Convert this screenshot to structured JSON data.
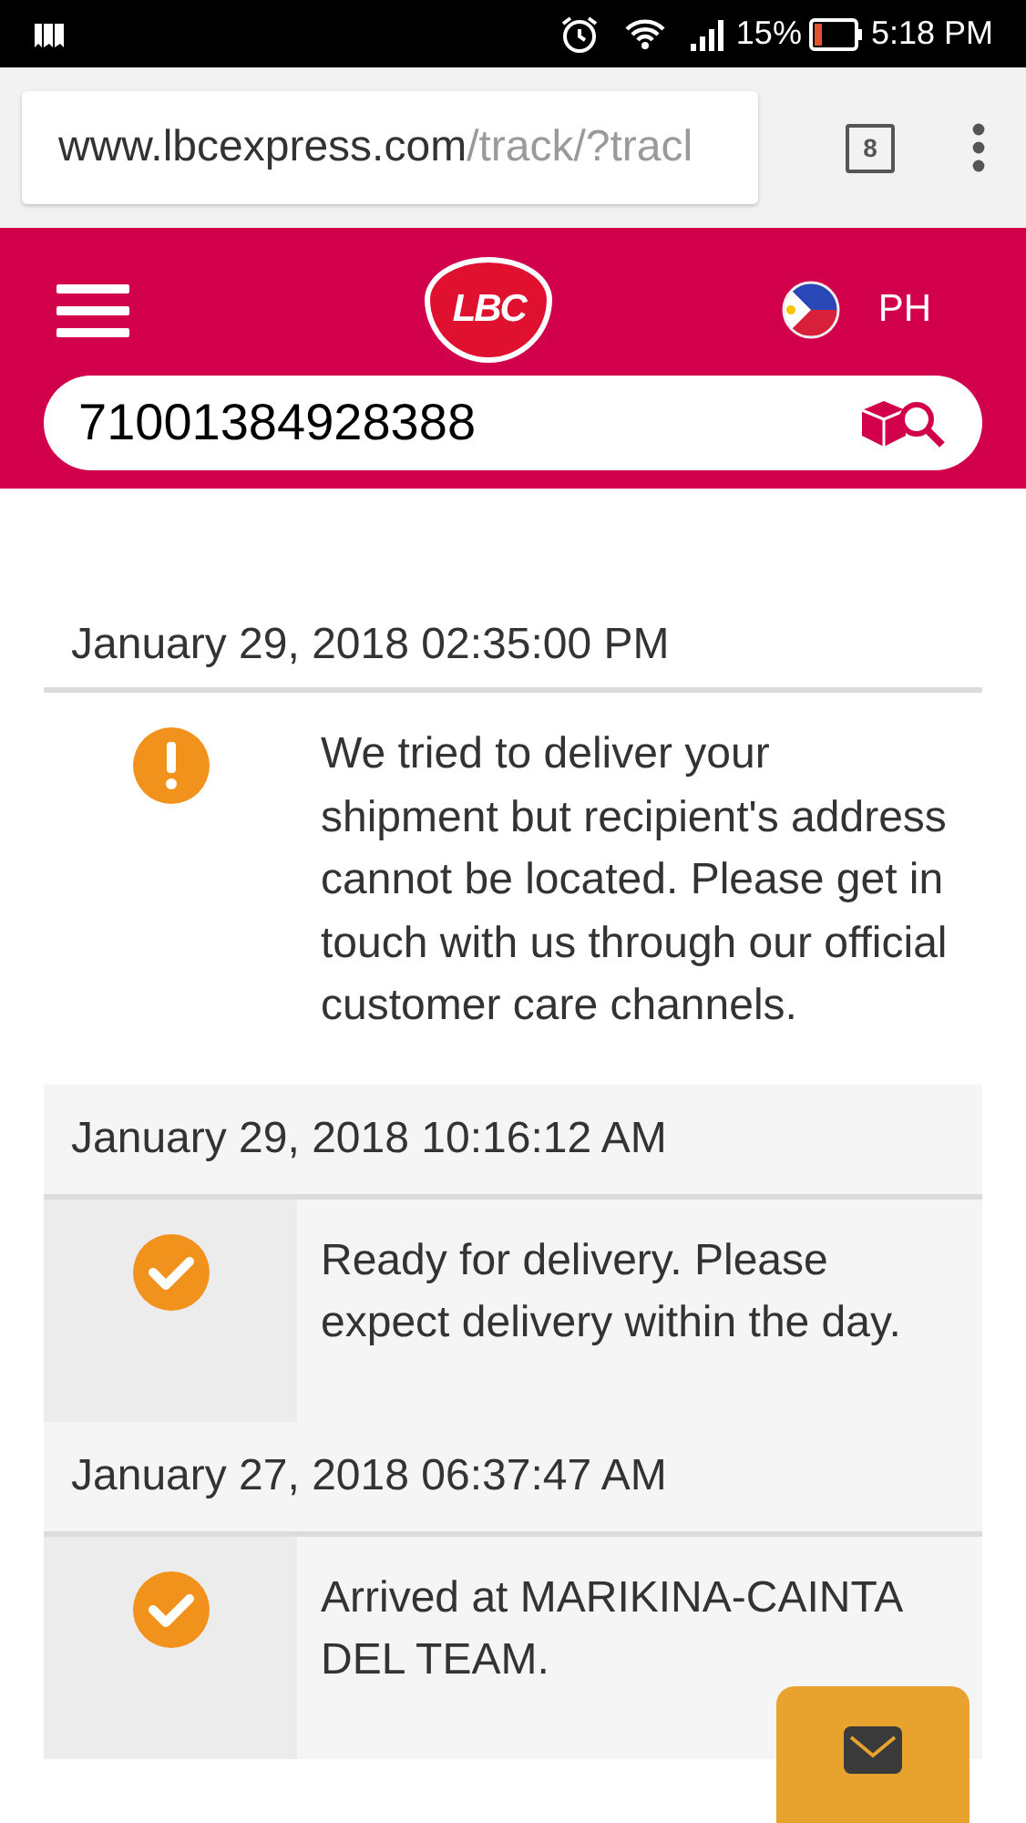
{
  "status_bar": {
    "battery": "15%",
    "time": "5:18 PM"
  },
  "browser": {
    "url_host": "www.lbcexpress.com",
    "url_path": "/track/?tracl",
    "tab_count": "8"
  },
  "header": {
    "logo": "LBC",
    "country": "PH"
  },
  "search": {
    "value": "71001384928388"
  },
  "events": [
    {
      "date": "January 29, 2018 02:35:00 PM",
      "kind": "alert",
      "message": "We tried to deliver your shipment but recipient's address cannot be located. Please get in touch with us through our official customer care channels."
    },
    {
      "date": "January 29, 2018 10:16:12 AM",
      "kind": "done",
      "message": "Ready for delivery. Please expect delivery within the day."
    },
    {
      "date": "January 27, 2018 06:37:47 AM",
      "kind": "done",
      "message": "Arrived at MARIKINA-CAINTA DEL TEAM."
    }
  ]
}
